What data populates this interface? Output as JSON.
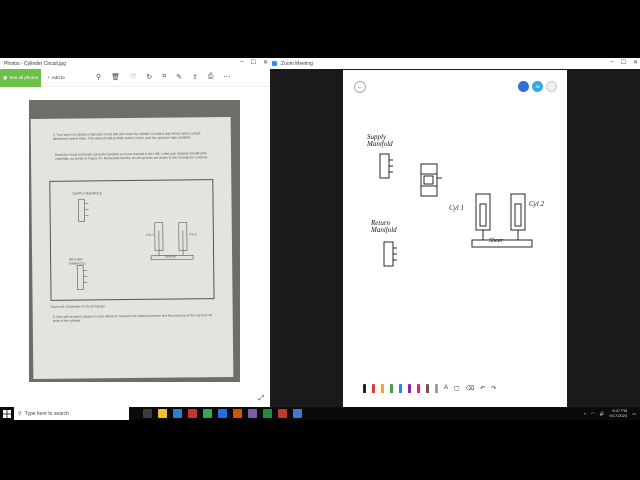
{
  "photos": {
    "title": "Photos - Cylinder Circuit.jpg",
    "see_all_label": "See all photos",
    "add_to_label": "Add to",
    "document": {
      "para1": "2. Your task is to design a hydraulic circuit that will cause the cylinder to extend and retract using a single directional control valve. The valve should provide control, return, and two pressure taps available.",
      "para2": "Draw the circuit schematic using the symbols you have learned in the LAB. Label your drawing including the manifolds, as shown in Figure #X. Remember that the circuit symbols are drawn to the rectangular container.",
      "supply_label": "SUPPLY MANIFOLD",
      "return_label": "RETURN MANIFOLD",
      "cyl1_label": "CYL1",
      "cyl2_label": "CYL2",
      "shear_label": "SHEAR",
      "figure_caption": "Figure #8: Schematic of Circuit Design",
      "para3": "3. Now add pressure gauges to your design to measure the system pressure and the pressure at the cap and rod ends of the cylinder."
    }
  },
  "zoom": {
    "title": "Zoom Meeting",
    "avatars": [
      {
        "initials": "",
        "color": "#2d6fd6"
      },
      {
        "initials": "JM",
        "color": "#36a8e0"
      },
      {
        "initials": "",
        "color": "#f0f0f0"
      }
    ],
    "whiteboard": {
      "supply_label": "Supply Manifold",
      "return_label": "Return Manifold",
      "cyl1_label": "Cyl 1",
      "cyl2_label": "Cyl 2",
      "shear_label": "Shear"
    },
    "pen_colors": [
      "#222222",
      "#e53935",
      "#f6a623",
      "#43a047",
      "#1e88e5",
      "#8e24aa",
      "#e91e63",
      "#795548",
      "#9e9e9e"
    ]
  },
  "taskbar": {
    "search_placeholder": "Type here to search",
    "time": "8:47 PM",
    "date": "9/17/2020",
    "app_colors": [
      "#3c3c3c",
      "#f2c12e",
      "#2f7fd1",
      "#c0392b",
      "#34a853",
      "#1f6fe0",
      "#d35400",
      "#7b5ea7",
      "#1e8f3e",
      "#c0392b",
      "#3a7bd5"
    ]
  }
}
